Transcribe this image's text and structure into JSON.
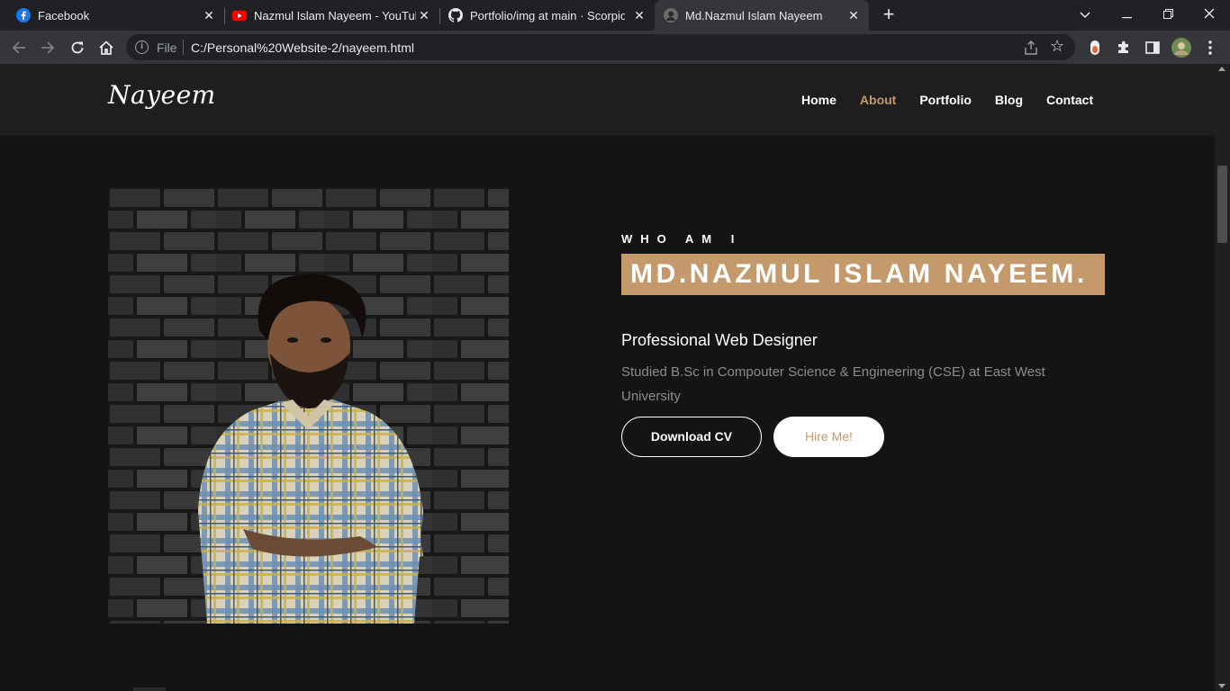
{
  "browser": {
    "tabs": [
      {
        "title": "Facebook",
        "icon": "facebook-icon"
      },
      {
        "title": "Nazmul Islam Nayeem - YouTube",
        "icon": "youtube-icon"
      },
      {
        "title": "Portfolio/img at main · ScorpionN",
        "icon": "github-icon"
      },
      {
        "title": "Md.Nazmul Islam Nayeem",
        "icon": "site-favicon",
        "active": true
      }
    ],
    "new_tab": "+",
    "omnibox": {
      "scheme_label": "File",
      "url": "C:/Personal%20Website-2/nayeem.html"
    }
  },
  "site": {
    "logo": "Nayeem",
    "nav": [
      {
        "label": "Home"
      },
      {
        "label": "About",
        "active": true
      },
      {
        "label": "Portfolio"
      },
      {
        "label": "Blog"
      },
      {
        "label": "Contact"
      }
    ]
  },
  "hero": {
    "kicker": "WHO AM I",
    "name": "MD.NAZMUL ISLAM NAYEEM.",
    "role": "Professional Web Designer",
    "description": "Studied B.Sc in Compouter Science & Engineering (CSE) at East West University",
    "download_cv": "Download CV",
    "hire_me": "Hire Me!"
  },
  "colors": {
    "accent": "#c4996c",
    "page_bg": "#141414",
    "header_bg": "#1e1e1e"
  }
}
